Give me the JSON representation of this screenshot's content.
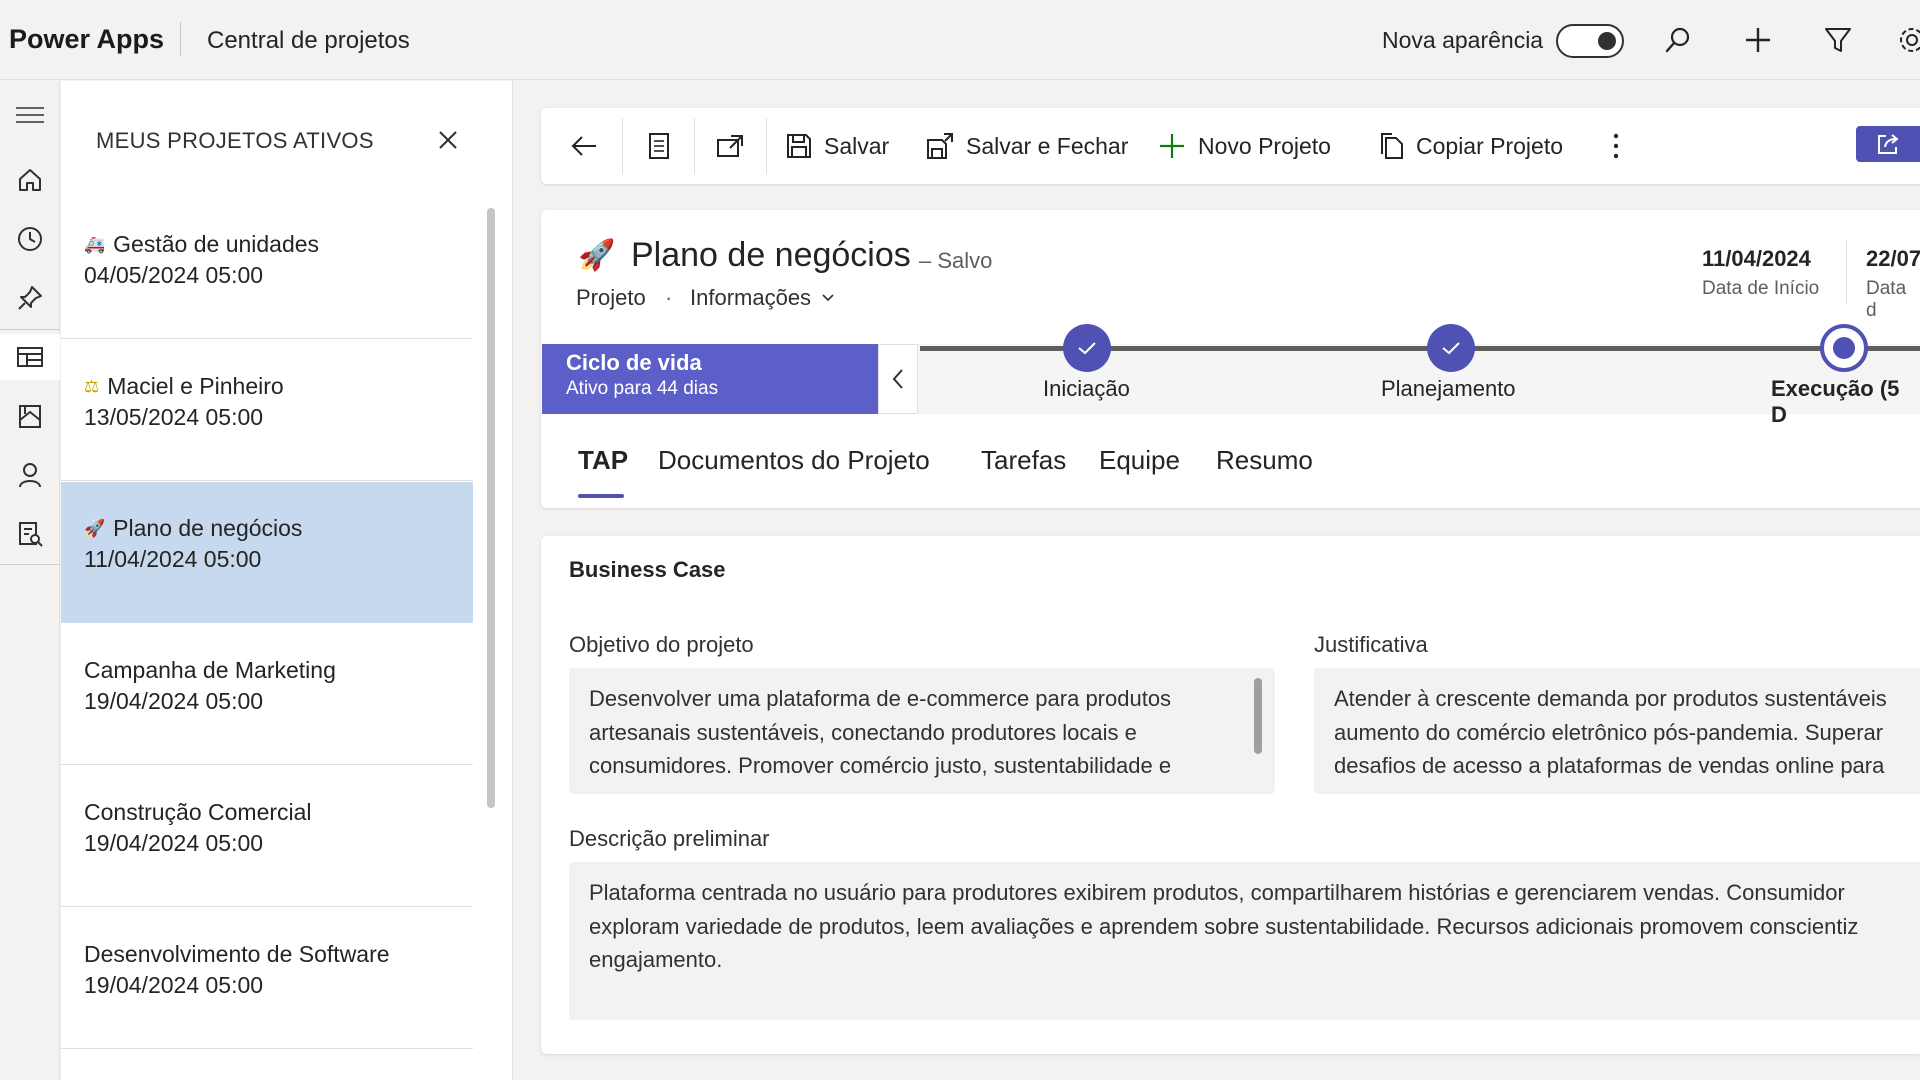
{
  "topbar": {
    "app_name": "Power Apps",
    "app_title": "Central de projetos",
    "new_look_label": "Nova aparência",
    "new_look_on": true,
    "icons": [
      "search-icon",
      "add-icon",
      "filter-icon",
      "settings-icon"
    ]
  },
  "rail": {
    "icons": [
      "menu-icon",
      "home-icon",
      "recent-icon",
      "pin-icon",
      "projects-icon",
      "documents-icon",
      "person-icon",
      "reports-icon"
    ],
    "selected": "projects-icon"
  },
  "panel": {
    "header": "MEUS PROJETOS ATIVOS",
    "projects": [
      {
        "emoji": "🚑",
        "name": "Gestão de unidades",
        "date": "04/05/2024 05:00",
        "selected": false
      },
      {
        "emoji": "⚖",
        "name": "Maciel e Pinheiro",
        "date": "13/05/2024 05:00",
        "selected": false
      },
      {
        "emoji": "🚀",
        "name": "Plano de negócios",
        "date": "11/04/2024 05:00",
        "selected": true
      },
      {
        "emoji": "",
        "name": "Campanha de Marketing",
        "date": "19/04/2024 05:00",
        "selected": false
      },
      {
        "emoji": "",
        "name": "Construção Comercial",
        "date": "19/04/2024 05:00",
        "selected": false
      },
      {
        "emoji": "",
        "name": "Desenvolvimento de Software",
        "date": "19/04/2024 05:00",
        "selected": false
      }
    ]
  },
  "commandbar": {
    "save": "Salvar",
    "save_close": "Salvar e Fechar",
    "new_project": "Novo Projeto",
    "copy_project": "Copiar Projeto"
  },
  "record": {
    "icon": "🚀",
    "title": "Plano de negócios",
    "saved_status": "– Salvo",
    "entity": "Projeto",
    "form": "Informações",
    "start_date": "11/04/2024",
    "start_date_label": "Data de Início",
    "end_date": "22/07",
    "end_date_label": "Data d"
  },
  "bpf": {
    "active_title": "Ciclo de vida",
    "active_sub": "Ativo para 44 dias",
    "stages": [
      {
        "label": "Iniciação",
        "status": "done"
      },
      {
        "label": "Planejamento",
        "status": "done"
      },
      {
        "label": "Execução  (5 D",
        "status": "current"
      }
    ]
  },
  "tabs": [
    {
      "label": "TAP",
      "active": true
    },
    {
      "label": "Documentos do Projeto",
      "active": false
    },
    {
      "label": "Tarefas",
      "active": false
    },
    {
      "label": "Equipe",
      "active": false
    },
    {
      "label": "Resumo",
      "active": false
    }
  ],
  "form": {
    "section_title": "Business Case",
    "objetivo_label": "Objetivo do projeto",
    "objetivo_lines": [
      "Desenvolver uma plataforma de e-commerce para produtos",
      "artesanais sustentáveis, conectando produtores locais e",
      "consumidores. Promover comércio justo, sustentabilidade e"
    ],
    "justificativa_label": "Justificativa",
    "justificativa_lines": [
      "Atender à crescente demanda por produtos sustentáveis",
      "aumento do comércio eletrônico pós-pandemia. Superar",
      "desafios de acesso a plataformas de vendas online para"
    ],
    "descricao_label": "Descrição preliminar",
    "descricao_lines": [
      "Plataforma centrada no usuário para produtores exibirem produtos, compartilharem histórias e gerenciarem vendas. Consumidor",
      "exploram variedade de produtos, leem avaliações e aprendem sobre sustentabilidade. Recursos adicionais promovem conscientiz",
      "engajamento."
    ]
  }
}
